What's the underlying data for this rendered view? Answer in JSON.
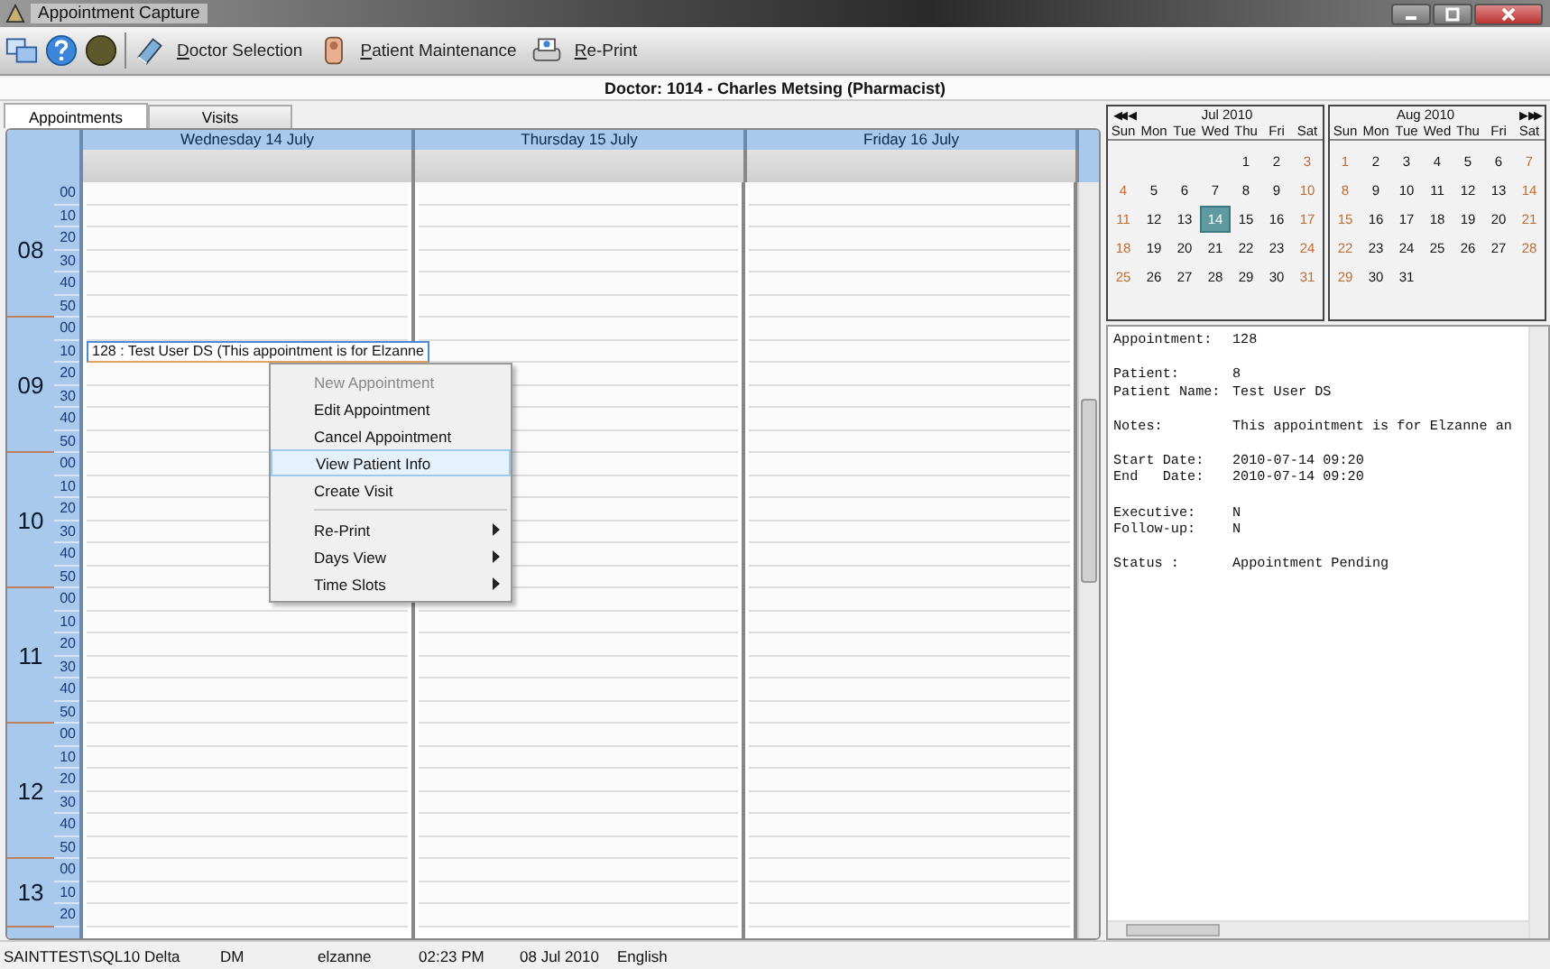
{
  "window": {
    "title": "Appointment Capture"
  },
  "toolbar": {
    "buttons": [
      {
        "label": "Doctor Selection"
      },
      {
        "label": "Patient Maintenance"
      },
      {
        "label": "Re-Print"
      }
    ]
  },
  "doctor_header": "Doctor: 1014 - Charles Metsing (Pharmacist)",
  "tabs": [
    {
      "label": "Appointments",
      "selected": true
    },
    {
      "label": "Visits",
      "selected": false
    }
  ],
  "schedule": {
    "days": [
      "Wednesday 14 July",
      "Thursday 15 July",
      "Friday 16 July"
    ],
    "hours": [
      {
        "hour": "08",
        "slots": [
          "00",
          "10",
          "20",
          "30",
          "40",
          "50"
        ]
      },
      {
        "hour": "09",
        "slots": [
          "00",
          "10",
          "20",
          "30",
          "40",
          "50"
        ]
      },
      {
        "hour": "10",
        "slots": [
          "00",
          "10",
          "20",
          "30",
          "40",
          "50"
        ]
      },
      {
        "hour": "11",
        "slots": [
          "00",
          "10",
          "20",
          "30",
          "40",
          "50"
        ]
      },
      {
        "hour": "12",
        "slots": [
          "00",
          "10",
          "20",
          "30",
          "40",
          "50"
        ]
      },
      {
        "hour": "13",
        "slots": [
          "00",
          "10",
          "20"
        ]
      }
    ],
    "appointment": {
      "text": "128 : Test User DS (This appointment is for Elzanne",
      "selected": true
    }
  },
  "context_menu": {
    "groups": [
      [
        {
          "label": "New Appointment",
          "disabled": true,
          "selected": false,
          "kind": "item"
        },
        {
          "label": "Edit Appointment",
          "disabled": false,
          "selected": false,
          "kind": "item"
        },
        {
          "label": "Cancel Appointment",
          "disabled": false,
          "selected": false,
          "kind": "item"
        },
        {
          "label": "View Patient Info",
          "disabled": false,
          "selected": true,
          "kind": "item"
        },
        {
          "label": "Create Visit",
          "disabled": false,
          "selected": false,
          "kind": "item"
        }
      ],
      [
        {
          "label": "Re-Print",
          "disabled": false,
          "selected": false,
          "kind": "submenu"
        },
        {
          "label": "Days View",
          "disabled": false,
          "selected": false,
          "kind": "submenu"
        },
        {
          "label": "Time Slots",
          "disabled": false,
          "selected": false,
          "kind": "submenu"
        }
      ]
    ]
  },
  "calendars": [
    {
      "title": "Jul 2010",
      "nav": [
        "◀◀",
        "◀"
      ],
      "weekdays": [
        "Sun",
        "Mon",
        "Tue",
        "Wed",
        "Thu",
        "Fri",
        "Sat"
      ],
      "weeks": [
        [
          {
            "d": "1",
            "selected": false
          },
          {
            "d": "2",
            "selected": false
          },
          {
            "d": "3",
            "selected": false
          }
        ],
        [
          {
            "d": "4",
            "selected": false
          },
          {
            "d": "5",
            "selected": false
          },
          {
            "d": "6",
            "selected": false
          },
          {
            "d": "7",
            "selected": false
          },
          {
            "d": "8",
            "selected": false
          },
          {
            "d": "9",
            "selected": false
          },
          {
            "d": "10",
            "selected": false
          }
        ],
        [
          {
            "d": "11",
            "selected": false
          },
          {
            "d": "12",
            "selected": false
          },
          {
            "d": "13",
            "selected": false
          },
          {
            "d": "14",
            "selected": true
          },
          {
            "d": "15",
            "selected": false
          },
          {
            "d": "16",
            "selected": false
          },
          {
            "d": "17",
            "selected": false
          }
        ],
        [
          {
            "d": "18",
            "selected": false
          },
          {
            "d": "19",
            "selected": false
          },
          {
            "d": "20",
            "selected": false
          },
          {
            "d": "21",
            "selected": false
          },
          {
            "d": "22",
            "selected": false
          },
          {
            "d": "23",
            "selected": false
          },
          {
            "d": "24",
            "selected": false
          }
        ],
        [
          {
            "d": "25",
            "selected": false
          },
          {
            "d": "26",
            "selected": false
          },
          {
            "d": "27",
            "selected": false
          },
          {
            "d": "28",
            "selected": false
          },
          {
            "d": "29",
            "selected": false
          },
          {
            "d": "30",
            "selected": false
          },
          {
            "d": "31",
            "selected": false
          }
        ]
      ]
    },
    {
      "title": "Aug 2010",
      "nav": [
        "▶",
        "▶▶"
      ],
      "weekdays": [
        "Sun",
        "Mon",
        "Tue",
        "Wed",
        "Thu",
        "Fri",
        "Sat"
      ],
      "weeks": [
        [
          {
            "d": "1",
            "selected": false
          },
          {
            "d": "2",
            "selected": false
          },
          {
            "d": "3",
            "selected": false
          },
          {
            "d": "4",
            "selected": false
          },
          {
            "d": "5",
            "selected": false
          },
          {
            "d": "6",
            "selected": false
          },
          {
            "d": "7",
            "selected": false
          }
        ],
        [
          {
            "d": "8",
            "selected": false
          },
          {
            "d": "9",
            "selected": false
          },
          {
            "d": "10",
            "selected": false
          },
          {
            "d": "11",
            "selected": false
          },
          {
            "d": "12",
            "selected": false
          },
          {
            "d": "13",
            "selected": false
          },
          {
            "d": "14",
            "selected": false
          }
        ],
        [
          {
            "d": "15",
            "selected": false
          },
          {
            "d": "16",
            "selected": false
          },
          {
            "d": "17",
            "selected": false
          },
          {
            "d": "18",
            "selected": false
          },
          {
            "d": "19",
            "selected": false
          },
          {
            "d": "20",
            "selected": false
          },
          {
            "d": "21",
            "selected": false
          }
        ],
        [
          {
            "d": "22",
            "selected": false
          },
          {
            "d": "23",
            "selected": false
          },
          {
            "d": "24",
            "selected": false
          },
          {
            "d": "25",
            "selected": false
          },
          {
            "d": "26",
            "selected": false
          },
          {
            "d": "27",
            "selected": false
          },
          {
            "d": "28",
            "selected": false
          }
        ],
        [
          {
            "d": "29",
            "selected": false
          },
          {
            "d": "30",
            "selected": false
          },
          {
            "d": "31",
            "selected": false
          }
        ]
      ]
    }
  ],
  "details": [
    [
      {
        "label": "Appointment:",
        "value": "128"
      }
    ],
    [
      {
        "label": "Patient:",
        "value": "8"
      },
      {
        "label": "Patient Name:",
        "value": "Test User DS"
      }
    ],
    [
      {
        "label": "Notes:",
        "value": "This appointment is for Elzanne an"
      }
    ],
    [
      {
        "label": "Start Date:",
        "value": "2010-07-14 09:20"
      },
      {
        "label": "End   Date:",
        "value": "2010-07-14 09:20"
      }
    ],
    [
      {
        "label": "Executive:",
        "value": "N"
      },
      {
        "label": "Follow-up:",
        "value": "N"
      }
    ],
    [
      {
        "label": "Status :",
        "value": "Appointment Pending"
      }
    ]
  ],
  "status_bar": [
    "SAINTTEST\\SQL10 Delta",
    "DM",
    "elzanne",
    "02:23 PM",
    "08 Jul 2010",
    "English"
  ]
}
